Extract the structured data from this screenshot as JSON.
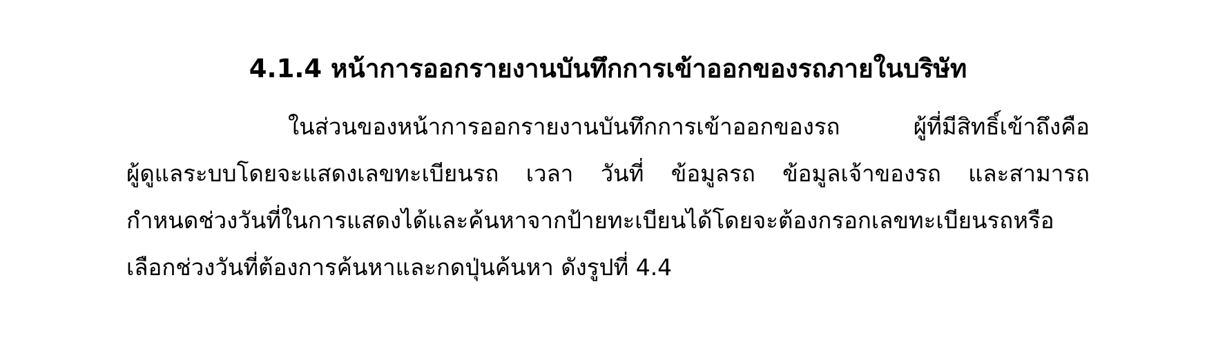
{
  "section": {
    "heading": "4.1.4 หน้าการออกรายงานบันทึกการเข้าออกของรถภายในบริษัท",
    "paragraph_lines": [
      "ในส่วนของหน้าการออกรายงานบันทึกการเข้าออกของรถ ผู้ที่มีสิทธิ์เข้าถึงคือ",
      "ผู้ดูแลระบบโดยจะแสดงเลขทะเบียนรถ เวลา วันที่ ข้อมูลรถ ข้อมูลเจ้าของรถ  และสามารถ",
      "กำหนดช่วงวันที่ในการแสดงได้และค้นหาจากป้ายทะเบียนได้โดยจะต้องกรอกเลขทะเบียนรถหรือ",
      "เลือกช่วงวันที่ต้องการค้นหาและกดปุ่นค้นหา ดังรูปที่ 4.4"
    ]
  }
}
